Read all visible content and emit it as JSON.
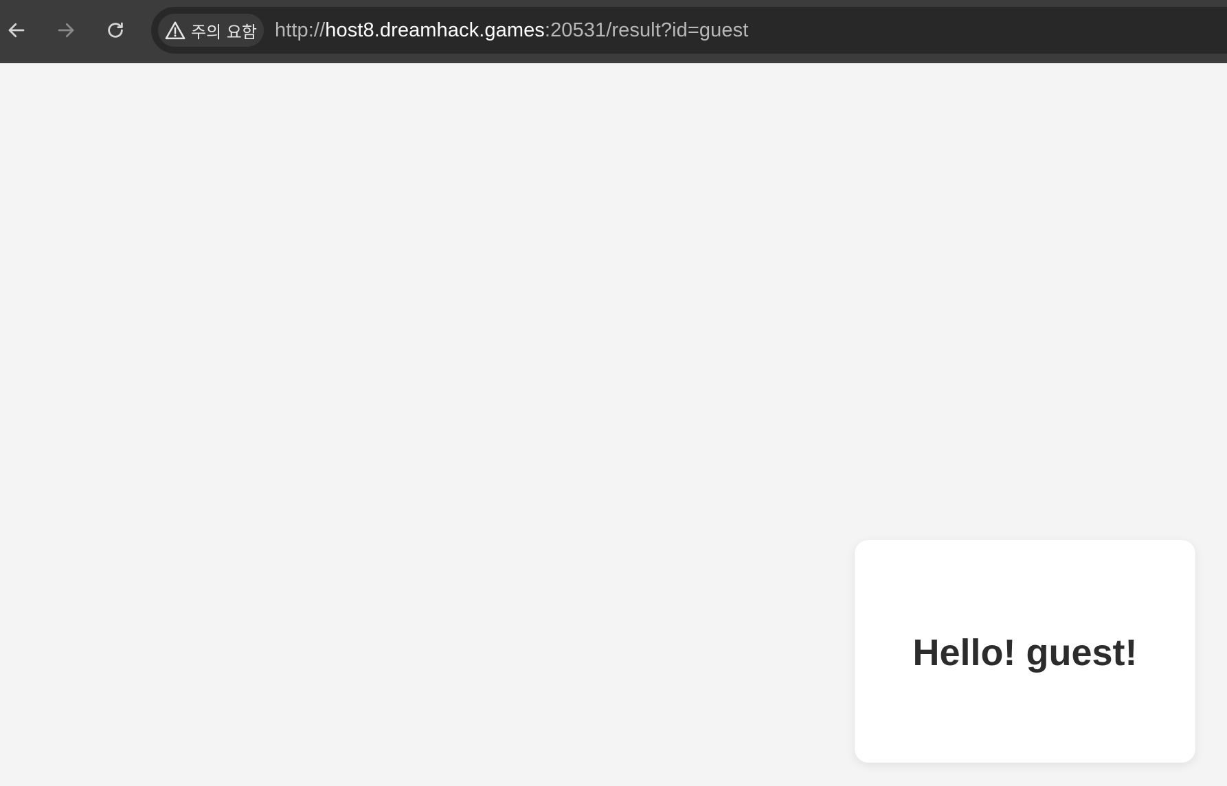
{
  "browser": {
    "security_label": "주의 요함",
    "url_scheme": "http://",
    "url_host": "host8.dreamhack.games",
    "url_rest": ":20531/result?id=guest"
  },
  "icons": {
    "back": "arrow-left",
    "forward": "arrow-right",
    "reload": "reload",
    "security": "warning-triangle"
  },
  "page": {
    "greeting": "Hello! guest!"
  },
  "colors": {
    "toolbar": "#3c3c3c",
    "omnibox": "#282828",
    "page_background": "#f4f4f4",
    "card_background": "#ffffff",
    "greeting_text": "#2c2c2c"
  }
}
